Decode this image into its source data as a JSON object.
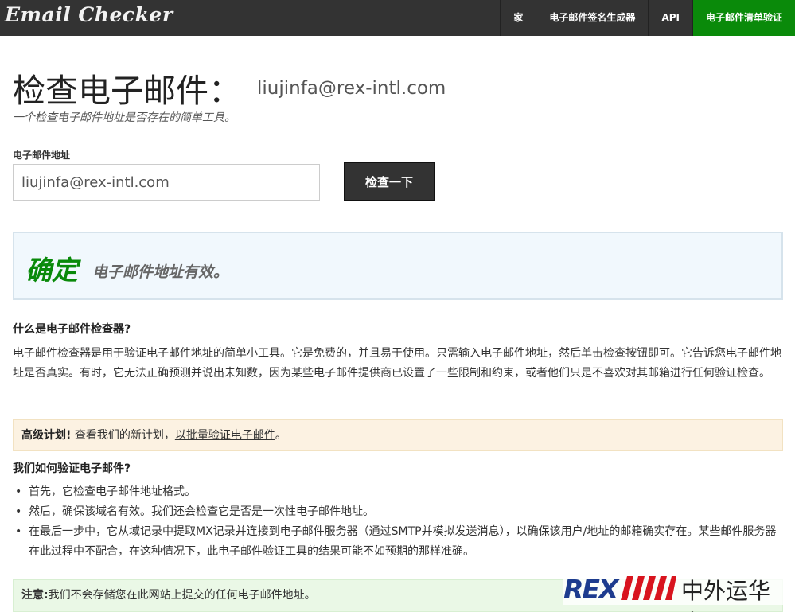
{
  "brand": "Email Checker",
  "nav": [
    {
      "label": "家",
      "active": false
    },
    {
      "label": "电子邮件签名生成器",
      "active": false
    },
    {
      "label": "API",
      "active": false
    },
    {
      "label": "电子邮件清单验证",
      "active": true
    }
  ],
  "header": {
    "title": "检查电子邮件：",
    "email": "liujinfa@rex-intl.com",
    "subtitle": "一个检查电子邮件地址是否存在的简单工具。"
  },
  "form": {
    "label": "电子邮件地址",
    "value": "liujinfa@rex-intl.com",
    "button": "检查一下"
  },
  "result": {
    "status": "确定",
    "message": "电子邮件地址有效。",
    "status_color": "#0a8a0a"
  },
  "what": {
    "heading": "什么是电子邮件检查器?",
    "text": "电子邮件检查器是用于验证电子邮件地址的简单小工具。它是免费的，并且易于使用。只需输入电子邮件地址，然后单击检查按钮即可。它告诉您电子邮件地址是否真实。有时，它无法正确预测并说出未知数，因为某些电子邮件提供商已设置了一些限制和约束，或者他们只是不喜欢对其邮箱进行任何验证检查。"
  },
  "plan": {
    "label": "高级计划!",
    "text": " 查看我们的新计划，",
    "link": "以批量验证电子邮件",
    "suffix": "。"
  },
  "how": {
    "heading": "我们如何验证电子邮件?",
    "steps": [
      "首先，它检查电子邮件地址格式。",
      "然后，确保该域名有效。我们还会检查它是否是一次性电子邮件地址。",
      "在最后一步中，它从域记录中提取MX记录并连接到电子邮件服务器（通过SMTP并模拟发送消息），以确保该用户/地址的邮箱确实存在。某些邮件服务器在此过程中不配合，在这种情况下，此电子邮件验证工具的结果可能不如预期的那样准确。"
    ]
  },
  "note": {
    "label": "注意:",
    "text": "我们不会存储您在此网站上提交的任何电子邮件地址。"
  },
  "watermark": {
    "logo": "REX",
    "text": "中外运华杰"
  }
}
